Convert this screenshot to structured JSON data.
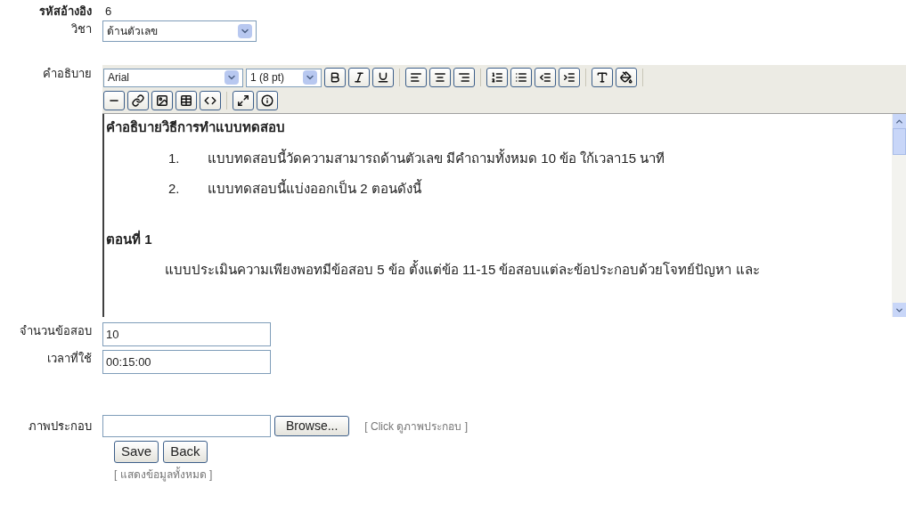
{
  "ref": {
    "label": "รหัสอ้างอิง",
    "value": "6"
  },
  "subject": {
    "label": "วิชา",
    "value": "ด้านตัวเลข"
  },
  "description": {
    "label": "คำอธิบาย",
    "font": "Arial",
    "size": "1 (8 pt)",
    "content": [
      {
        "kind": "heading",
        "text": "คำอธิบายวิธีการทำแบบทดสอบ"
      },
      {
        "kind": "item",
        "number": "1.",
        "text": "แบบทดสอบนี้วัดความสามารถด้านตัวเลข มีคำถามทั้งหมด 10 ข้อ ใก้เวลา15 นาที"
      },
      {
        "kind": "item",
        "number": "2.",
        "text": "แบบทดสอบนี้แบ่งออกเป็น 2 ตอนดังนี้"
      },
      {
        "kind": "heading",
        "text": "ตอนที่ 1"
      },
      {
        "kind": "para",
        "text": "แบบประเมินความเพียงพอทมีข้อสอบ 5 ข้อ ตั้งแต่ข้อ 11-15 ข้อสอบแต่ละข้อประกอบด้วยโจทย์ปัญหา และ"
      }
    ]
  },
  "count": {
    "label": "จำนวนข้อสอบ",
    "value": "10"
  },
  "time": {
    "label": "เวลาที่ใช้",
    "value": "00:15:00"
  },
  "picture": {
    "label": "ภาพประกอบ",
    "browse": "Browse...",
    "link": "[ Click ดูภาพประกอบ ]"
  },
  "buttons": [
    "Save",
    "Back"
  ],
  "show_all": "[ แสดงข้อมูลทั้งหมด ]"
}
